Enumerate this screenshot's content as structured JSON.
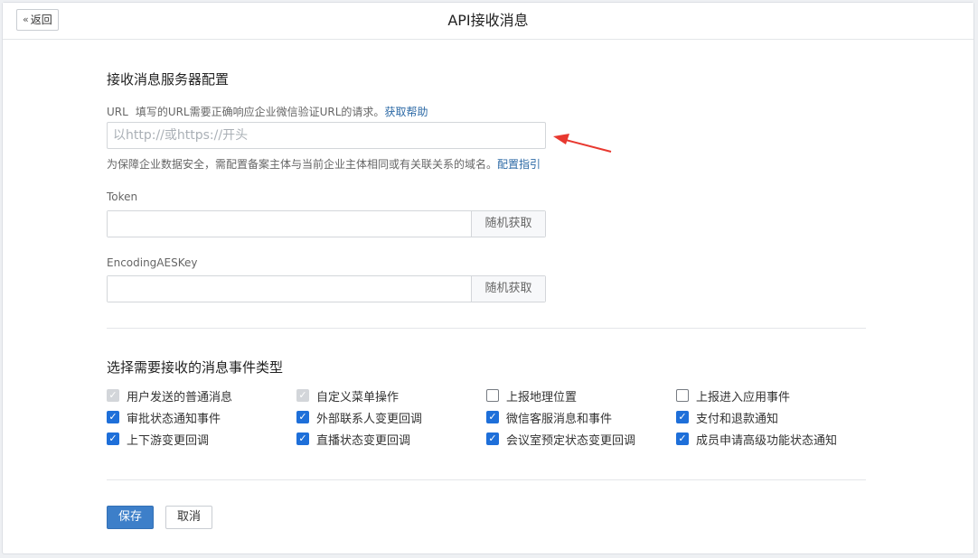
{
  "header": {
    "back_label": "返回",
    "title": "API接收消息"
  },
  "server_config": {
    "title": "接收消息服务器配置",
    "url": {
      "label": "URL",
      "hint": "填写的URL需要正确响应企业微信验证URL的请求。",
      "help_link": "获取帮助",
      "placeholder": "以http://或https://开头",
      "value": ""
    },
    "domain_note": "为保障企业数据安全，需配置备案主体与当前企业主体相同或有关联关系的域名。",
    "domain_link": "配置指引",
    "token": {
      "label": "Token",
      "value": "",
      "random_button": "随机获取"
    },
    "aes_key": {
      "label": "EncodingAESKey",
      "value": "",
      "random_button": "随机获取"
    }
  },
  "events": {
    "title": "选择需要接收的消息事件类型",
    "items": [
      {
        "label": "用户发送的普通消息",
        "state": "disabled"
      },
      {
        "label": "自定义菜单操作",
        "state": "disabled"
      },
      {
        "label": "上报地理位置",
        "state": "unchecked"
      },
      {
        "label": "上报进入应用事件",
        "state": "unchecked"
      },
      {
        "label": "审批状态通知事件",
        "state": "checked"
      },
      {
        "label": "外部联系人变更回调",
        "state": "checked"
      },
      {
        "label": "微信客服消息和事件",
        "state": "checked"
      },
      {
        "label": "支付和退款通知",
        "state": "checked"
      },
      {
        "label": "上下游变更回调",
        "state": "checked"
      },
      {
        "label": "直播状态变更回调",
        "state": "checked"
      },
      {
        "label": "会议室预定状态变更回调",
        "state": "checked"
      },
      {
        "label": "成员申请高级功能状态通知",
        "state": "checked"
      }
    ]
  },
  "actions": {
    "save": "保存",
    "cancel": "取消"
  },
  "colors": {
    "accent": "#3d7fc9",
    "link": "#2d6aa6",
    "annotation_arrow": "#e8382f"
  }
}
